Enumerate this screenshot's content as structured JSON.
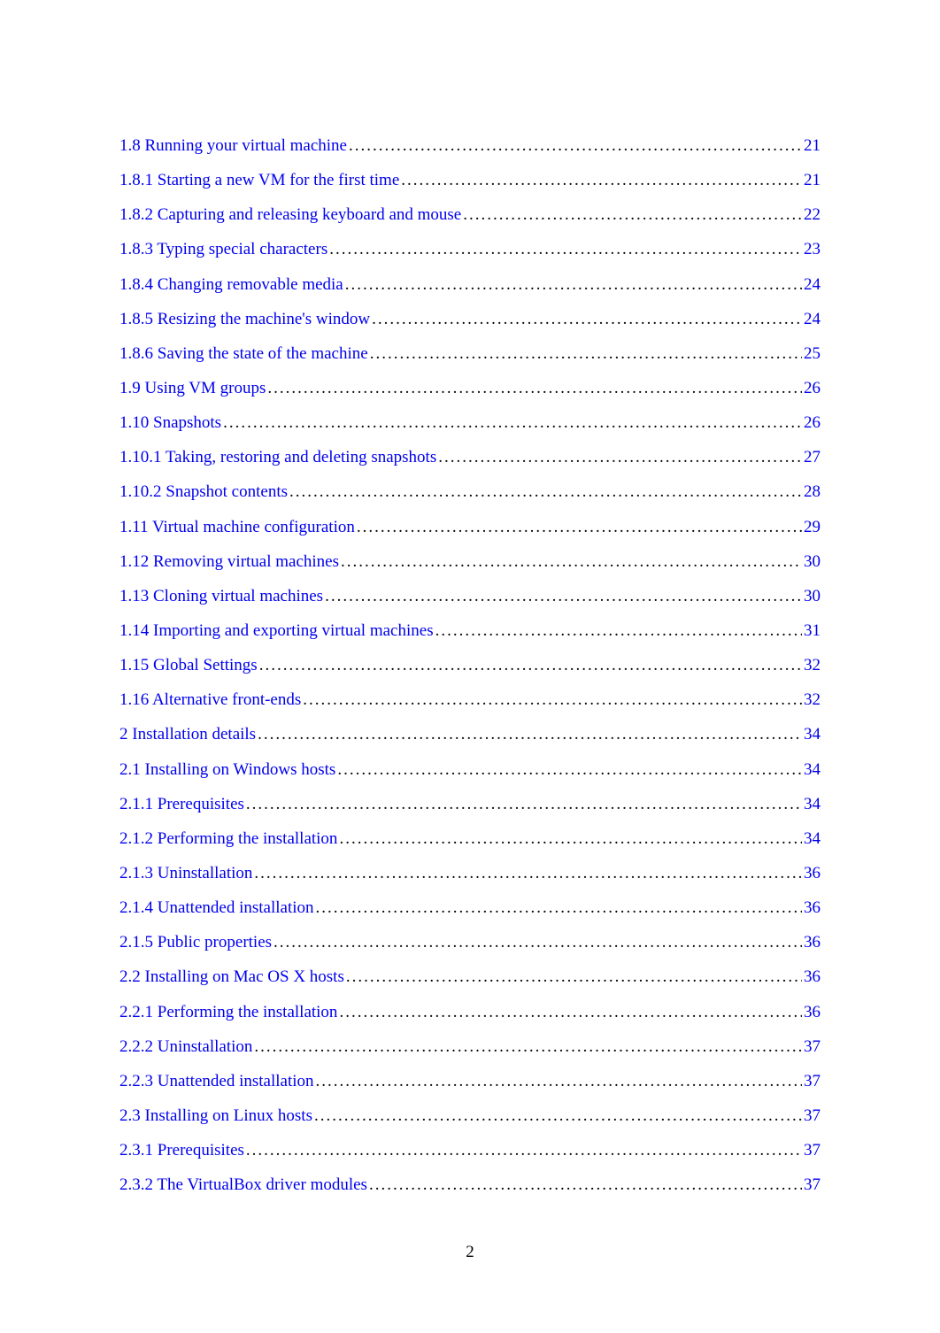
{
  "toc": [
    {
      "title": "1.8 Running your virtual machine",
      "page": "21"
    },
    {
      "title": "1.8.1 Starting a new VM for the first time",
      "page": "21"
    },
    {
      "title": "1.8.2 Capturing and releasing keyboard and mouse ",
      "page": "22"
    },
    {
      "title": "1.8.3 Typing special characters",
      "page": " 23"
    },
    {
      "title": "1.8.4 Changing removable media",
      "page": "24"
    },
    {
      "title": "1.8.5 Resizing the machine's window",
      "page": " 24"
    },
    {
      "title": "1.8.6 Saving the state of the machine ",
      "page": "25"
    },
    {
      "title": "1.9 Using VM groups",
      "page": "26"
    },
    {
      "title": "1.10 Snapshots",
      "page": "26"
    },
    {
      "title": "1.10.1 Taking, restoring and deleting snapshots ",
      "page": "27"
    },
    {
      "title": "1.10.2 Snapshot contents ",
      "page": " 28"
    },
    {
      "title": "1.11 Virtual machine configuration",
      "page": "29"
    },
    {
      "title": "1.12 Removing virtual machines",
      "page": "30"
    },
    {
      "title": "1.13 Cloning virtual machines",
      "page": "30"
    },
    {
      "title": "1.14 Importing and exporting virtual machines",
      "page": "31"
    },
    {
      "title": "1.15 Global Settings",
      "page": " 32"
    },
    {
      "title": "1.16 Alternative front-ends ",
      "page": "32"
    },
    {
      "title": "2 Installation details ",
      "page": "34"
    },
    {
      "title": "2.1 Installing on Windows hosts",
      "page": "34"
    },
    {
      "title": "2.1.1 Prerequisites ",
      "page": " 34"
    },
    {
      "title": "2.1.2 Performing the installation",
      "page": " 34"
    },
    {
      "title": "2.1.3 Uninstallation",
      "page": "36"
    },
    {
      "title": "2.1.4 Unattended installation ",
      "page": " 36"
    },
    {
      "title": "2.1.5 Public properties",
      "page": "36"
    },
    {
      "title": "2.2 Installing on Mac OS X hosts",
      "page": " 36"
    },
    {
      "title": "2.2.1 Performing the installation",
      "page": " 36"
    },
    {
      "title": "2.2.2 Uninstallation",
      "page": "37"
    },
    {
      "title": "2.2.3 Unattended installation ",
      "page": " 37"
    },
    {
      "title": "2.3 Installing on Linux hosts",
      "page": "37"
    },
    {
      "title": "2.3.1 Prerequisites ",
      "page": " 37"
    },
    {
      "title": "2.3.2 The VirtualBox driver modules",
      "page": " 37"
    }
  ],
  "page_number": "2"
}
